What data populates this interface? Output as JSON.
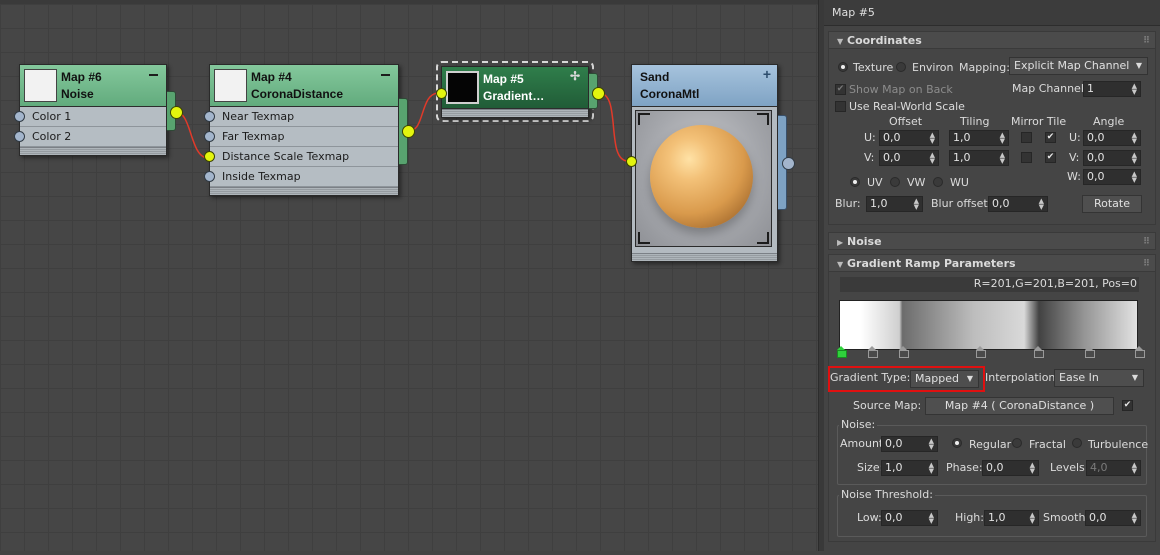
{
  "nodes": {
    "noise": {
      "title": "Map #6",
      "subtitle": "Noise",
      "slots": [
        "Color 1",
        "Color 2"
      ]
    },
    "distance": {
      "title": "Map #4",
      "subtitle": "CoronaDistance",
      "slots": [
        "Near Texmap",
        "Far Texmap",
        "Distance Scale Texmap",
        "Inside Texmap"
      ]
    },
    "gradient": {
      "title": "Map #5",
      "subtitle": "Gradient…"
    },
    "material": {
      "title": "Sand",
      "subtitle": "CoronaMtl"
    }
  },
  "panel": {
    "title": "Map #5",
    "coordinates": {
      "header": "Coordinates",
      "texture": "Texture",
      "environ": "Environ",
      "mapping_label": "Mapping:",
      "mapping_value": "Explicit Map Channel",
      "show_map_on_back": "Show Map on Back",
      "map_channel_label": "Map Channel:",
      "map_channel_value": "1",
      "use_real_world": "Use Real-World Scale",
      "col_offset": "Offset",
      "col_tiling": "Tiling",
      "col_mirror_tile": "Mirror Tile",
      "col_angle": "Angle",
      "u_label": "U:",
      "v_label": "V:",
      "w_label": "W:",
      "u_offset": "0,0",
      "v_offset": "0,0",
      "u_tiling": "1,0",
      "v_tiling": "1,0",
      "u_angle": "0,0",
      "v_angle": "0,0",
      "w_angle": "0,0",
      "uv": "UV",
      "vw": "VW",
      "wu": "WU",
      "blur_label": "Blur:",
      "blur_value": "1,0",
      "blur_offset_label": "Blur offset:",
      "blur_offset_value": "0,0",
      "rotate": "Rotate"
    },
    "noise_rollout": {
      "header": "Noise"
    },
    "gradient_ramp": {
      "header": "Gradient Ramp Parameters",
      "readout": "R=201,G=201,B=201, Pos=0",
      "gradient_type_label": "Gradient Type:",
      "gradient_type_value": "Mapped",
      "interpolation_label": "Interpolation:",
      "interpolation_value": "Ease In",
      "source_map_label": "Source Map:",
      "source_map_value": "Map #4  ( CoronaDistance )",
      "noise_group": "Noise:",
      "amount_label": "Amount:",
      "amount_value": "0,0",
      "regular": "Regular",
      "fractal": "Fractal",
      "turbulence": "Turbulence",
      "size_label": "Size:",
      "size_value": "1,0",
      "phase_label": "Phase:",
      "phase_value": "0,0",
      "levels_label": "Levels:",
      "levels_value": "4,0",
      "threshold_group": "Noise Threshold:",
      "low_label": "Low:",
      "low_value": "0,0",
      "high_label": "High:",
      "high_value": "1,0",
      "smooth_label": "Smooth:",
      "smooth_value": "0,0"
    }
  },
  "colors": {
    "highlight": "#e01010",
    "socket": "#e4f50e",
    "wire": "#e03a2a",
    "active_flag": "#2fd23c"
  }
}
